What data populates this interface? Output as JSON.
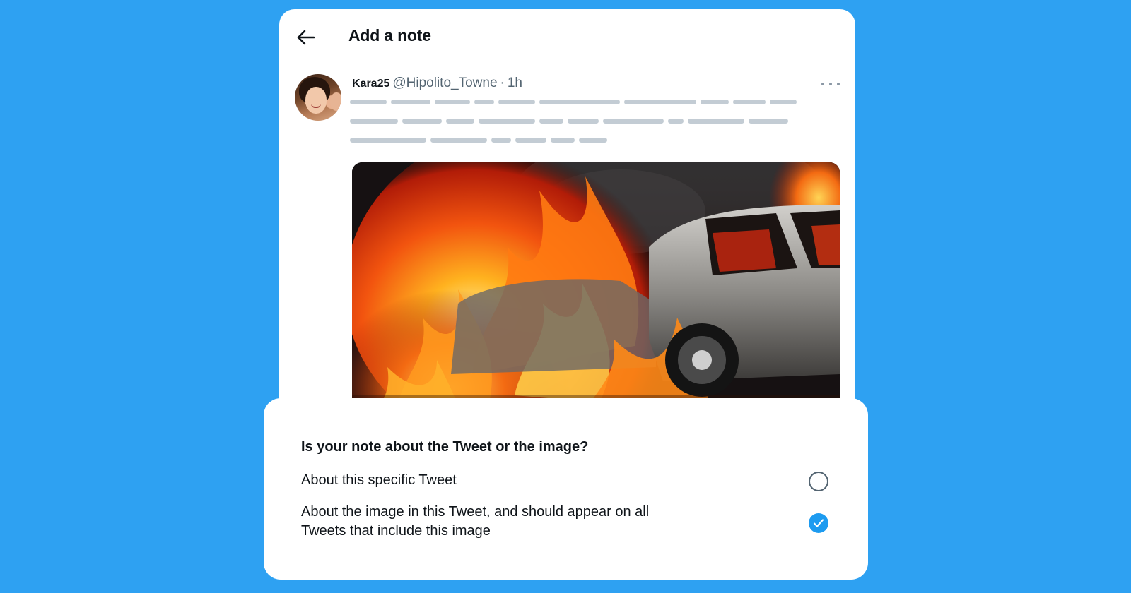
{
  "header": {
    "title": "Add a note",
    "back_icon": "arrow-left-icon"
  },
  "tweet": {
    "author_name": "Kara25",
    "author_handle": "@Hipolito_Towne",
    "separator": "·",
    "time": "1h",
    "more_icon": "more-horizontal-icon",
    "image_description_icon": "burning-car-image"
  },
  "dialog": {
    "question": "Is your note about the Tweet or the image?",
    "options": [
      {
        "label": "About this specific Tweet",
        "selected": false
      },
      {
        "label": "About the image in this Tweet, and should appear on all Tweets that include this image",
        "selected": true
      }
    ]
  },
  "colors": {
    "background": "#2ea1f2",
    "accent": "#1d9bf0",
    "text_primary": "#0f1419",
    "text_secondary": "#536471",
    "skeleton": "#c3ccd4"
  }
}
